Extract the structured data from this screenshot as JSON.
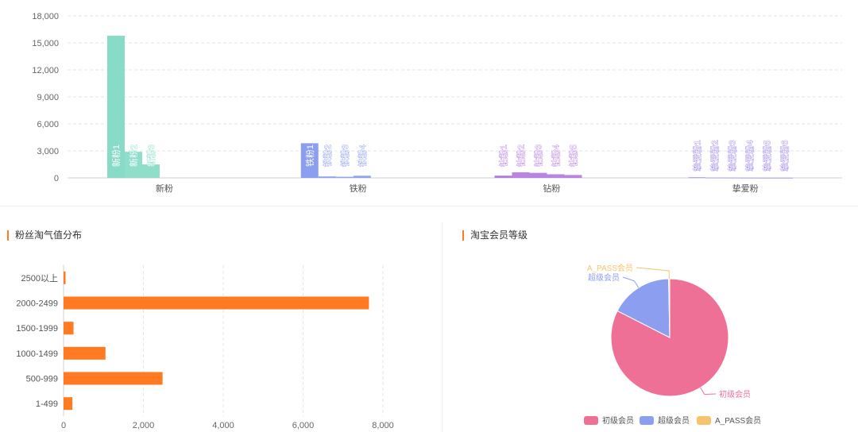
{
  "panels": {
    "fan_distribution_title": "粉丝淘气值分布",
    "membership_title": "淘宝会员等级"
  },
  "chart_data": [
    {
      "type": "bar",
      "categories": [
        "新粉",
        "铁粉",
        "钻粉",
        "挚爱粉"
      ],
      "y_ticks": [
        "0",
        "3,000",
        "6,000",
        "9,000",
        "12,000",
        "15,000",
        "18,000"
      ],
      "ylim": [
        0,
        18000
      ],
      "grid": true,
      "groups": [
        {
          "category": "新粉",
          "color": "#88dcc7",
          "bars": [
            {
              "label": "新粉1",
              "value": 15800
            },
            {
              "label": "新粉2",
              "value": 2900
            },
            {
              "label": "新粉3",
              "value": 1500
            }
          ]
        },
        {
          "category": "铁粉",
          "color": "#8b9ef0",
          "bars": [
            {
              "label": "铁粉1",
              "value": 3850
            },
            {
              "label": "铁粉2",
              "value": 160
            },
            {
              "label": "铁粉3",
              "value": 120
            },
            {
              "label": "铁粉4",
              "value": 240
            }
          ]
        },
        {
          "category": "钻粉",
          "color": "#b67de0",
          "bars": [
            {
              "label": "钻粉1",
              "value": 250
            },
            {
              "label": "钻粉2",
              "value": 620
            },
            {
              "label": "钻粉3",
              "value": 560
            },
            {
              "label": "钻粉4",
              "value": 400
            },
            {
              "label": "钻粉5",
              "value": 320
            }
          ]
        },
        {
          "category": "挚爱粉",
          "color": "#9c83e6",
          "bars": [
            {
              "label": "挚爱粉1",
              "value": 60
            },
            {
              "label": "挚爱粉2",
              "value": 30
            },
            {
              "label": "挚爱粉3",
              "value": 25
            },
            {
              "label": "挚爱粉4",
              "value": 20
            },
            {
              "label": "挚爱粉5",
              "value": 15
            },
            {
              "label": "挚爱粉6",
              "value": 15
            }
          ]
        }
      ]
    },
    {
      "type": "bar",
      "orientation": "horizontal",
      "color": "#ff7a21",
      "categories": [
        "2500以上",
        "2000-2499",
        "1500-1999",
        "1000-1499",
        "500-999",
        "1-499"
      ],
      "values": [
        50,
        7650,
        250,
        1050,
        2480,
        220
      ],
      "x_ticks": [
        "0",
        "2,000",
        "4,000",
        "6,000",
        "8,000"
      ],
      "xlim": [
        0,
        8000
      ],
      "grid": true
    },
    {
      "type": "pie",
      "labels": [
        "初级会员",
        "超级会员",
        "A_PASS会员"
      ],
      "values": [
        82.5,
        17.2,
        0.3
      ],
      "colors": [
        "#ef7097",
        "#8b9ef0",
        "#f7c46c"
      ],
      "legend": [
        "初级会员",
        "超级会员",
        "A_PASS会员"
      ],
      "legend_position": "bottom"
    }
  ]
}
